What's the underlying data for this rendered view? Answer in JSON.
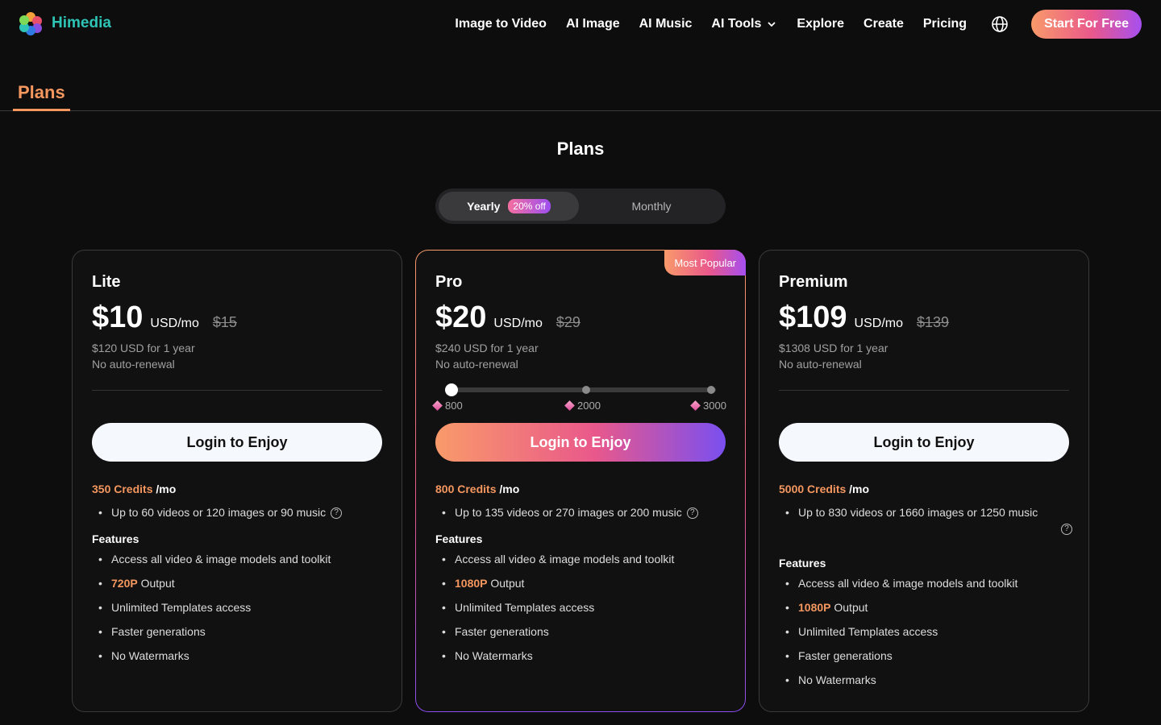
{
  "brand": {
    "name": "Himedia"
  },
  "nav": {
    "links": [
      "Image to Video",
      "AI Image",
      "AI Music",
      "AI Tools",
      "Explore",
      "Create",
      "Pricing"
    ],
    "cta": "Start For Free"
  },
  "tabs": {
    "active": "Plans"
  },
  "page": {
    "title": "Plans"
  },
  "billing": {
    "yearly": "Yearly",
    "discount": "20% off",
    "monthly": "Monthly",
    "selected": "Yearly"
  },
  "plans": [
    {
      "name": "Lite",
      "price": "$10",
      "unit": "USD/mo",
      "old_price": "$15",
      "yearly_total": "$120 USD for 1 year",
      "renewal": "No auto-renewal",
      "cta": "Login to Enjoy",
      "credits": "350 Credits",
      "per": "/mo",
      "allowance": "Up to 60 videos or 120 images or 90 music",
      "features_title": "Features",
      "features": [
        "Access all video & image models and toolkit",
        "720P",
        "Output",
        "Unlimited Templates access",
        "Faster generations",
        "No Watermarks"
      ]
    },
    {
      "name": "Pro",
      "badge": "Most Popular",
      "price": "$20",
      "unit": "USD/mo",
      "old_price": "$29",
      "yearly_total": "$240 USD for 1 year",
      "renewal": "No auto-renewal",
      "slider": {
        "options": [
          "800",
          "2000",
          "3000"
        ],
        "selected": "800"
      },
      "cta": "Login to Enjoy",
      "credits": "800 Credits",
      "per": "/mo",
      "allowance": "Up to 135 videos or 270 images or 200 music",
      "features_title": "Features",
      "features": [
        "Access all video & image models and toolkit",
        "1080P",
        "Output",
        "Unlimited Templates access",
        "Faster generations",
        "No Watermarks"
      ]
    },
    {
      "name": "Premium",
      "price": "$109",
      "unit": "USD/mo",
      "old_price": "$139",
      "yearly_total": "$1308 USD for 1 year",
      "renewal": "No auto-renewal",
      "cta": "Login to Enjoy",
      "credits": "5000 Credits",
      "per": "/mo",
      "allowance": "Up to 830 videos or 1660 images or 1250 music",
      "features_title": "Features",
      "features": [
        "Access all video & image models and toolkit",
        "1080P",
        "Output",
        "Unlimited Templates access",
        "Faster generations",
        "No Watermarks"
      ]
    }
  ],
  "colors": {
    "accent": "#f4975f",
    "brand": "#2ec4b6",
    "background": "#0d0d0d"
  },
  "icons": [
    "logo-icon",
    "chevron-down-icon",
    "globe-icon",
    "gem-icon",
    "help-icon"
  ]
}
